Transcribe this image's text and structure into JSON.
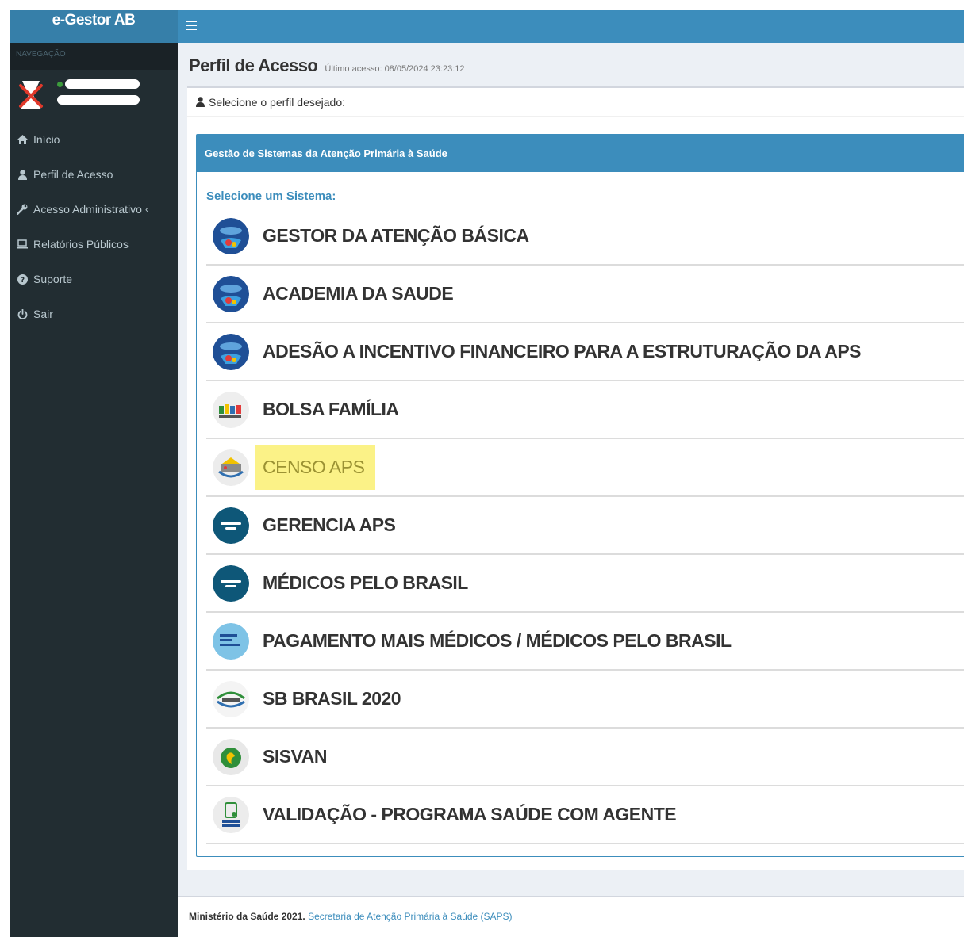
{
  "brand": {
    "title": "e-Gestor AB"
  },
  "sidebar": {
    "header": "NAVEGAÇÃO",
    "items": [
      {
        "label": "Início",
        "icon": "home-icon"
      },
      {
        "label": "Perfil de Acesso",
        "icon": "user-icon"
      },
      {
        "label": "Acesso Administrativo",
        "icon": "wrench-icon",
        "chevron": "‹"
      },
      {
        "label": "Relatórios Públicos",
        "icon": "laptop-icon"
      },
      {
        "label": "Suporte",
        "icon": "question-circle-icon"
      },
      {
        "label": "Sair",
        "icon": "power-icon"
      }
    ]
  },
  "page": {
    "title": "Perfil de Acesso",
    "last_access": "Último acesso: 08/05/2024 23:23:12",
    "box_title": "Selecione o perfil desejado:",
    "panel_title": "Gestão de Sistemas da Atenção Primária à Saúde",
    "select_label": "Selecione um Sistema:"
  },
  "systems": [
    {
      "name": "GESTOR DA ATENÇÃO BÁSICA",
      "logo": "egestor-logo"
    },
    {
      "name": "ACADEMIA DA SAUDE",
      "logo": "egestor-logo"
    },
    {
      "name": "ADESÃO A INCENTIVO FINANCEIRO PARA A ESTRUTURAÇÃO DA APS",
      "logo": "egestor-logo"
    },
    {
      "name": "BOLSA FAMÍLIA",
      "logo": "bolsa-familia-logo"
    },
    {
      "name": "CENSO APS",
      "logo": "censo-aps-logo",
      "highlighted": true
    },
    {
      "name": "GERENCIA APS",
      "logo": "gerencia-aps-logo"
    },
    {
      "name": "MÉDICOS PELO BRASIL",
      "logo": "gerencia-aps-logo"
    },
    {
      "name": "PAGAMENTO MAIS MÉDICOS / MÉDICOS PELO BRASIL",
      "logo": "mais-medicos-logo"
    },
    {
      "name": "SB BRASIL 2020",
      "logo": "sb-brasil-logo"
    },
    {
      "name": "SISVAN",
      "logo": "sisvan-logo"
    },
    {
      "name": "VALIDAÇÃO - PROGRAMA SAÚDE COM AGENTE",
      "logo": "saude-com-agente-logo"
    }
  ],
  "footer": {
    "ministry": "Ministério da Saúde 2021.",
    "link": "Secretaria de Atenção Primária à Saúde (SAPS)"
  },
  "colors": {
    "primary": "#3c8dbc",
    "sidebar_bg": "#222d32",
    "highlight": "#fbf287"
  }
}
